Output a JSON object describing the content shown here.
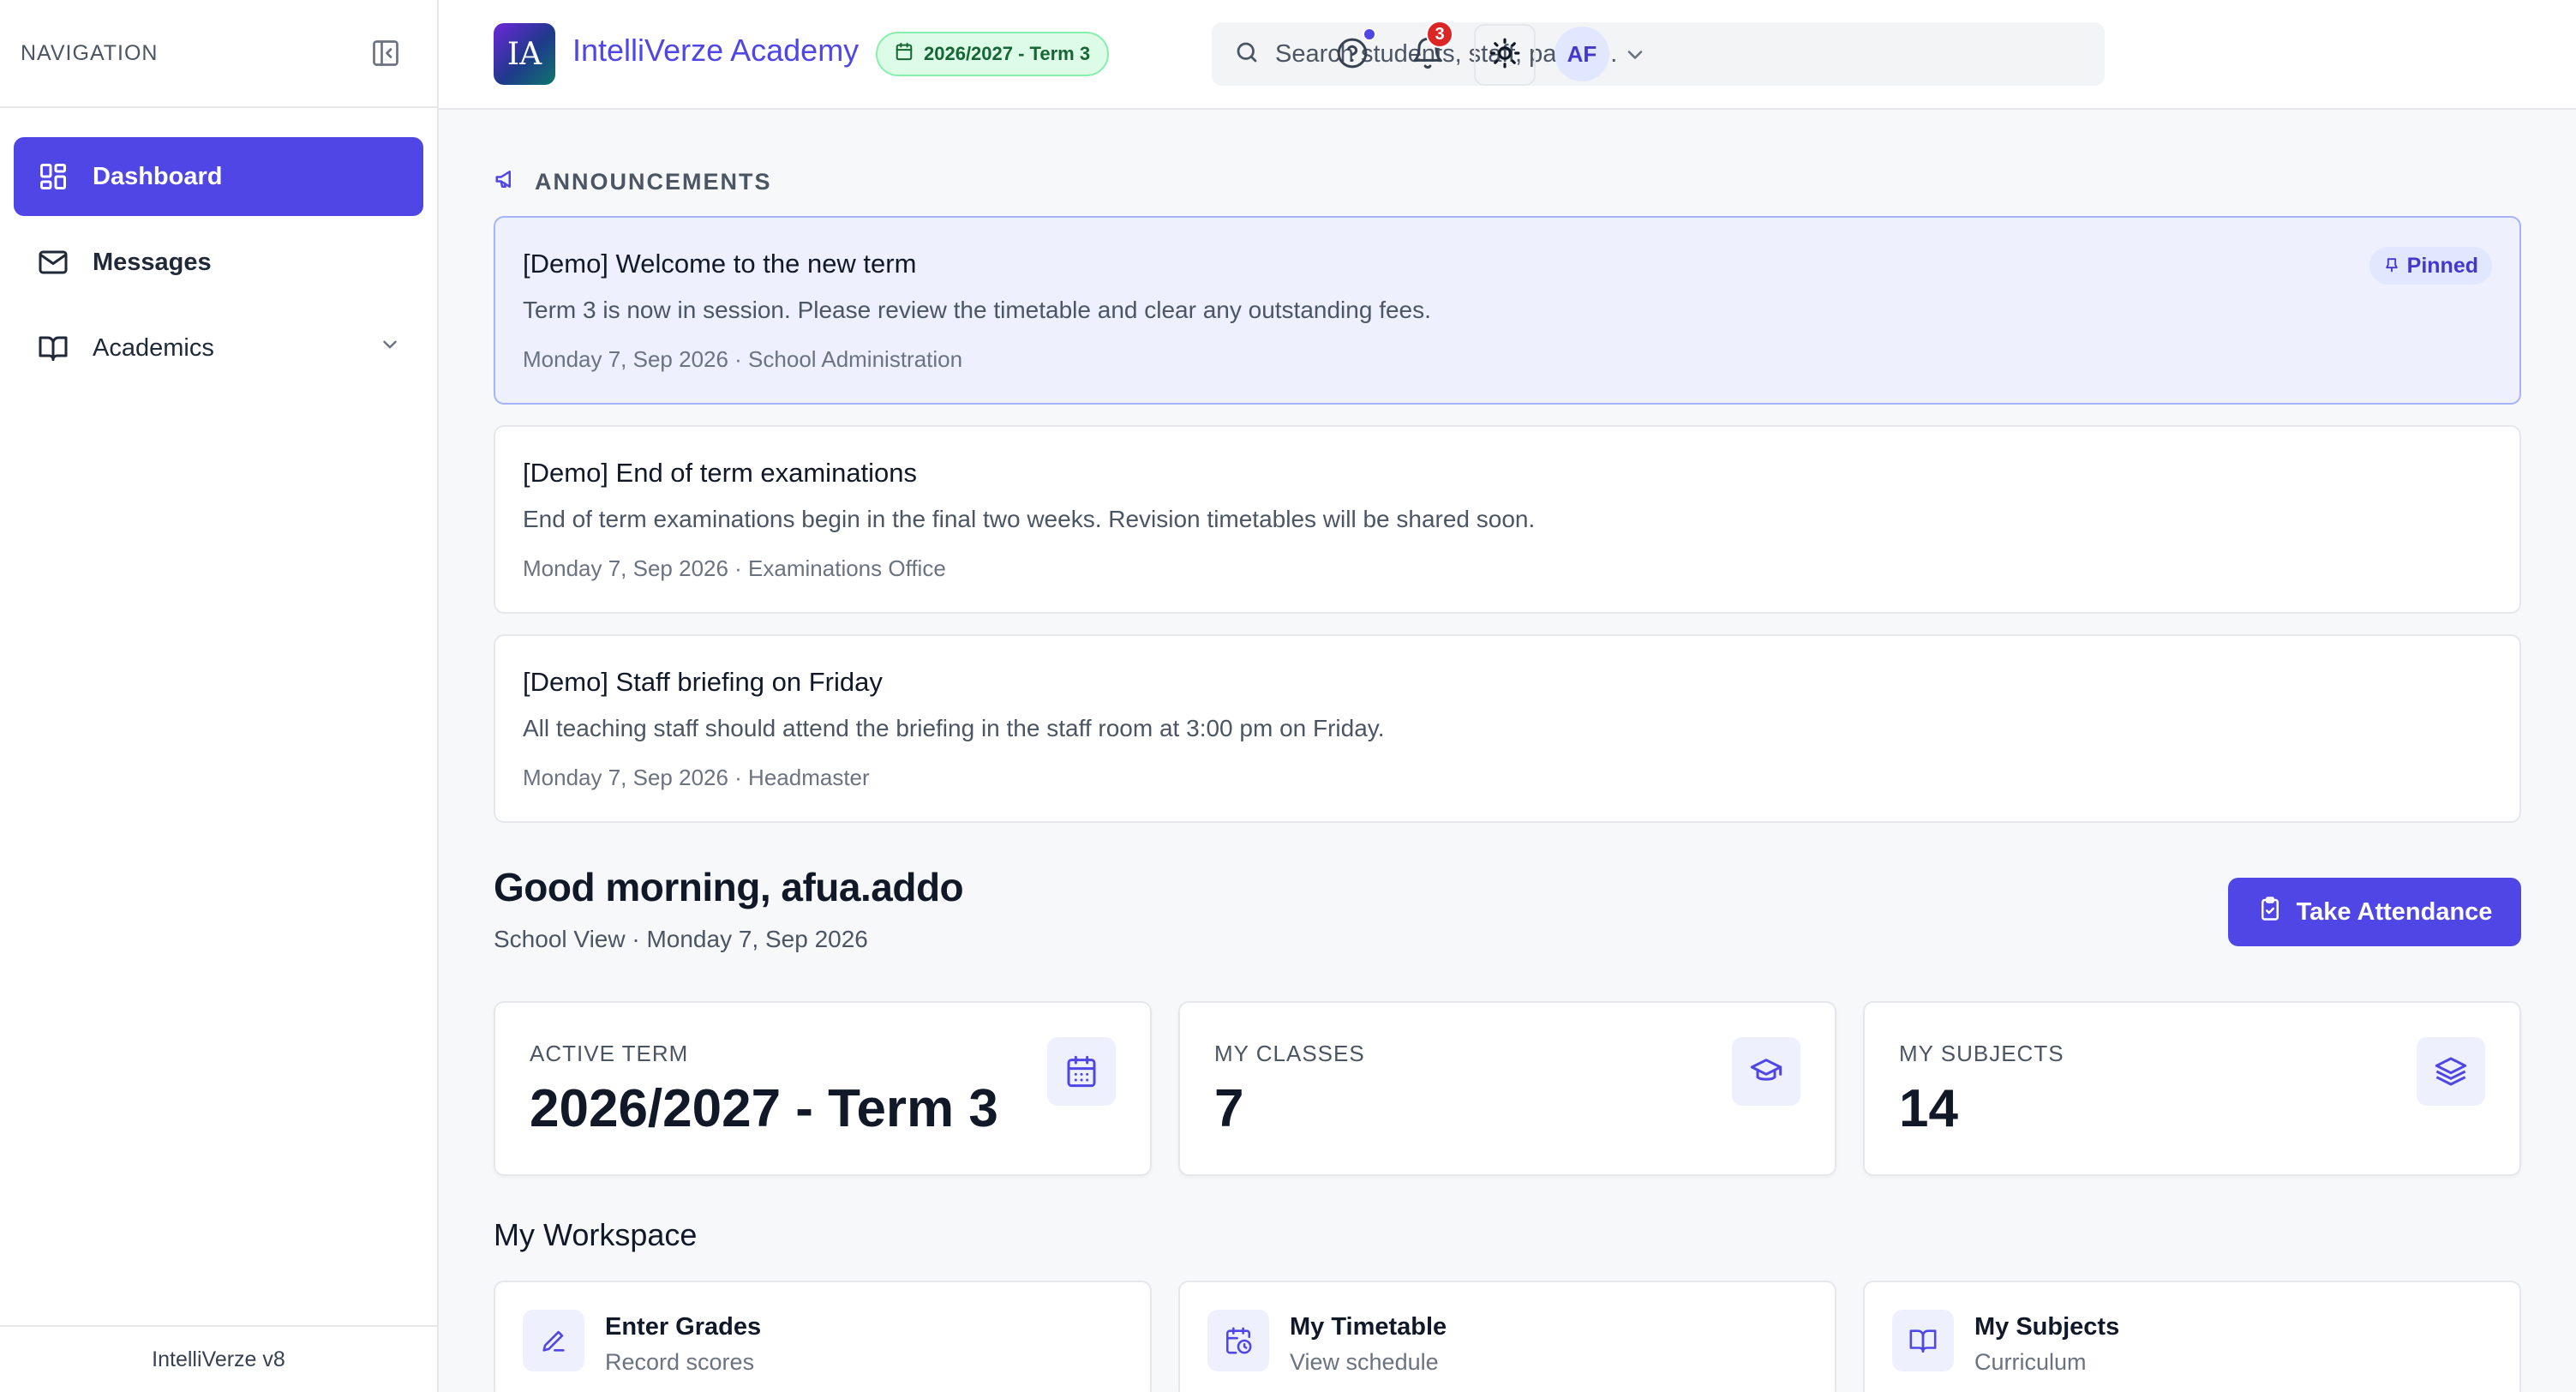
{
  "sidebar": {
    "title": "NAVIGATION",
    "items": [
      {
        "label": "Dashboard",
        "icon": "dashboard-icon",
        "active": true
      },
      {
        "label": "Messages",
        "icon": "mail-icon",
        "active": false
      },
      {
        "label": "Academics",
        "icon": "book-icon",
        "active": false,
        "expandable": true
      }
    ],
    "footer": "IntelliVerze v8"
  },
  "header": {
    "logo_text": "IA",
    "app_name": "IntelliVerze Academy",
    "term_badge": "2026/2027 - Term 3",
    "search_placeholder": "Search students, staff, pages...",
    "notification_count": "3",
    "avatar_initials": "AF"
  },
  "announcements": {
    "heading": "ANNOUNCEMENTS",
    "items": [
      {
        "title": "[Demo] Welcome to the new term",
        "body": "Term 3 is now in session. Please review the timetable and clear any outstanding fees.",
        "meta": "Monday 7, Sep 2026 · School Administration",
        "pinned": true,
        "pin_label": "Pinned"
      },
      {
        "title": "[Demo] End of term examinations",
        "body": "End of term examinations begin in the final two weeks. Revision timetables will be shared soon.",
        "meta": "Monday 7, Sep 2026 · Examinations Office",
        "pinned": false
      },
      {
        "title": "[Demo] Staff briefing on Friday",
        "body": "All teaching staff should attend the briefing in the staff room at 3:00 pm on Friday.",
        "meta": "Monday 7, Sep 2026 · Headmaster",
        "pinned": false
      }
    ]
  },
  "greeting": {
    "title": "Good morning, afua.addo",
    "subtitle": "School View · Monday 7, Sep 2026",
    "action_label": "Take Attendance"
  },
  "stats": [
    {
      "label": "ACTIVE TERM",
      "value": "2026/2027 - Term 3",
      "icon": "calendar-icon"
    },
    {
      "label": "MY CLASSES",
      "value": "7",
      "icon": "graduation-cap-icon"
    },
    {
      "label": "MY SUBJECTS",
      "value": "14",
      "icon": "layers-icon"
    }
  ],
  "workspace": {
    "title": "My Workspace",
    "cards": [
      {
        "title": "Enter Grades",
        "subtitle": "Record scores",
        "icon": "pencil-icon"
      },
      {
        "title": "My Timetable",
        "subtitle": "View schedule",
        "icon": "calendar-clock-icon"
      },
      {
        "title": "My Subjects",
        "subtitle": "Curriculum",
        "icon": "book-open-icon"
      }
    ]
  },
  "colors": {
    "accent": "#4f46e5",
    "term_badge_bg": "#dcfce7",
    "notification_badge": "#dc2626"
  }
}
